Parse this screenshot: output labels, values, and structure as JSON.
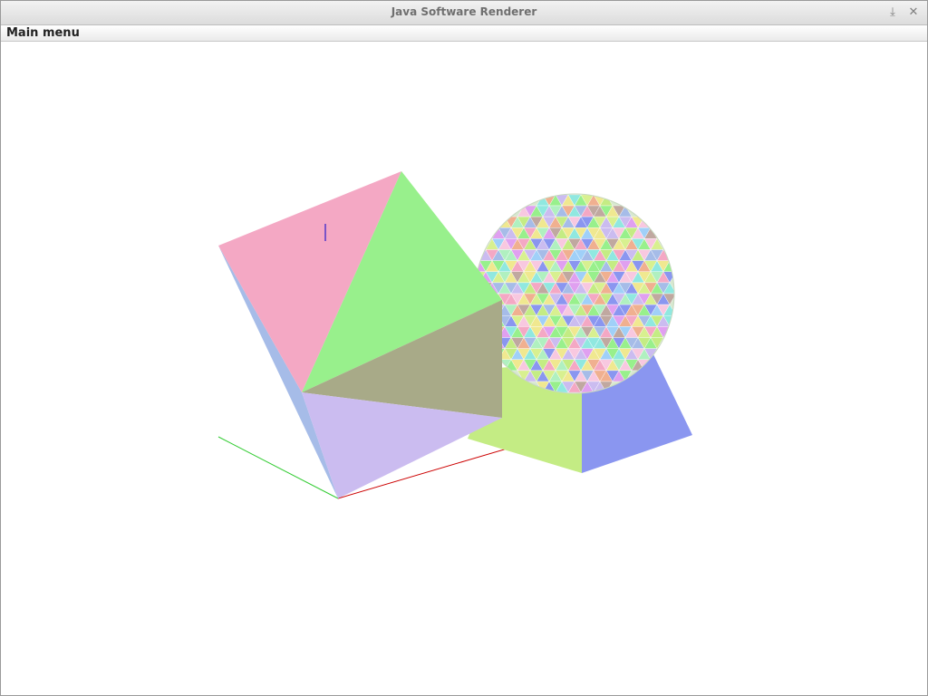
{
  "window": {
    "title": "Java Software Renderer",
    "minimize_icon": "download-arrow-icon",
    "close_icon": "close-icon"
  },
  "menubar": {
    "items": [
      {
        "label": "Main menu"
      }
    ]
  },
  "scene": {
    "objects": [
      "octahedron",
      "cube",
      "sphere",
      "x-axis",
      "y-axis",
      "z-axis"
    ],
    "colors": {
      "pink": "#f4a8c4",
      "green": "#98f08c",
      "olive": "#a8aa88",
      "lavender": "#cbbcf0",
      "light_blue": "#a6bce8",
      "yellow_green": "#c4ec84",
      "blue": "#8a96f0",
      "axis_x": "#cc0000",
      "axis_y": "#33cc33",
      "axis_z": "#0000cc"
    }
  }
}
